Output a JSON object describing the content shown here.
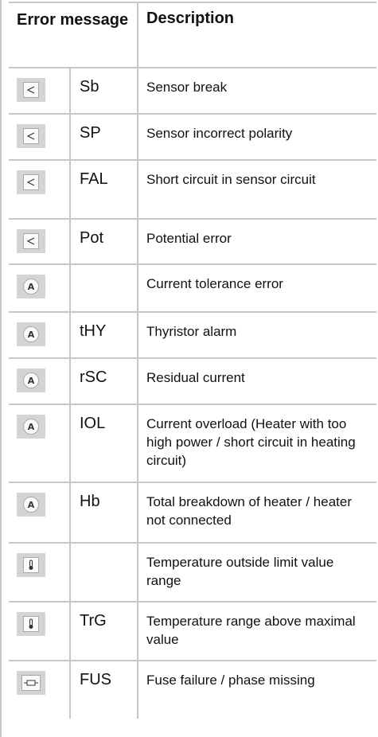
{
  "header": {
    "error_message": "Error message",
    "description": "Description"
  },
  "rows": [
    {
      "icon": "sensor-icon",
      "code": "Sb",
      "description": "Sensor break"
    },
    {
      "icon": "sensor-icon",
      "code": "SP",
      "description": "Sensor incorrect polarity"
    },
    {
      "icon": "sensor-icon",
      "code": "FAL",
      "description": "Short circuit in sensor circuit"
    },
    {
      "icon": "sensor-icon",
      "code": "Pot",
      "description": "Potential error"
    },
    {
      "icon": "ampere-icon",
      "code": "",
      "description": "Current tolerance error"
    },
    {
      "icon": "ampere-icon",
      "code": "tHY",
      "description": "Thyristor alarm"
    },
    {
      "icon": "ampere-icon",
      "code": "rSC",
      "description": "Residual current"
    },
    {
      "icon": "ampere-icon",
      "code": "IOL",
      "description": "Current overload (Heater with too high power / short circuit in heating circuit)"
    },
    {
      "icon": "ampere-icon",
      "code": "Hb",
      "description": "Total breakdown of heater / heater not connected"
    },
    {
      "icon": "thermometer-icon",
      "code": "",
      "description": "Temperature outside limit value range"
    },
    {
      "icon": "thermometer-icon",
      "code": "TrG",
      "description": "Temperature range above maximal value"
    },
    {
      "icon": "fuse-icon",
      "code": "FUS",
      "description": "Fuse failure / phase missing"
    }
  ]
}
